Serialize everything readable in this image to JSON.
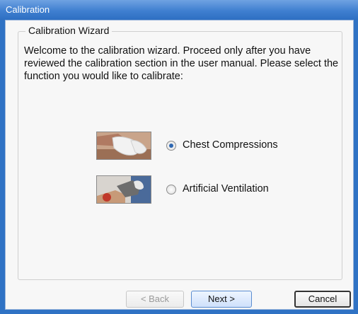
{
  "window": {
    "title": "Calibration"
  },
  "wizard": {
    "group_title": "Calibration Wizard",
    "intro": "Welcome to the calibration wizard.  Proceed only after you have reviewed the calibration section in the user manual.  Please select the function you would like to calibrate:",
    "options": [
      {
        "label": "Chest Compressions",
        "selected": true,
        "icon": "chest-compressions-image"
      },
      {
        "label": "Artificial Ventilation",
        "selected": false,
        "icon": "artificial-ventilation-image"
      }
    ]
  },
  "buttons": {
    "back": {
      "label": "< Back",
      "enabled": false
    },
    "next": {
      "label": "Next >",
      "enabled": true
    },
    "cancel": {
      "label": "Cancel",
      "enabled": true
    }
  }
}
